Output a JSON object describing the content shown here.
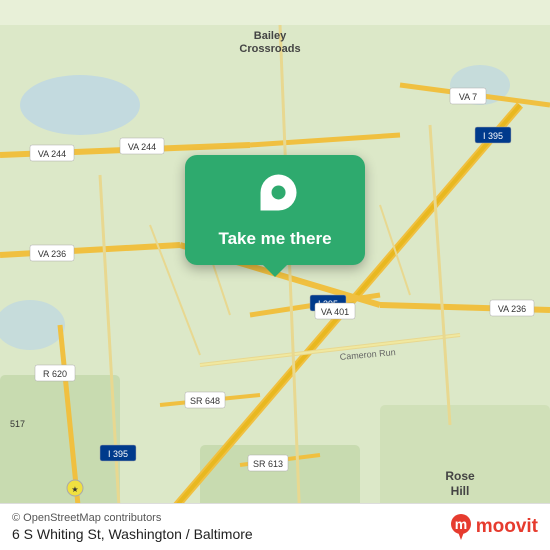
{
  "map": {
    "background_color": "#dce8c8",
    "center": {
      "lat": 38.84,
      "lon": -77.07
    }
  },
  "popup": {
    "label": "Take me there",
    "bg_color": "#2eaa6e"
  },
  "bottom_bar": {
    "osm_credit": "© OpenStreetMap contributors",
    "address": "6 S Whiting St, Washington / Baltimore"
  },
  "moovit": {
    "logo_text": "moovit",
    "logo_color": "#e63b2e"
  },
  "road_labels": [
    "VA 244",
    "VA 236",
    "VA 7",
    "I 395",
    "VA 401",
    "SR 648",
    "SR 613",
    "VA 236",
    "R 620",
    "517",
    "Bailey Crossroads",
    "Cameron Run",
    "Rose Hill"
  ]
}
